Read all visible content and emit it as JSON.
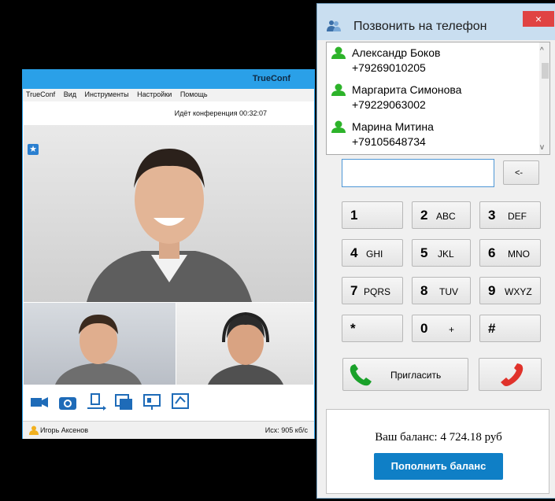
{
  "left_window": {
    "title": "TrueConf",
    "menu": [
      "TrueConf",
      "Вид",
      "Инструменты",
      "Настройки",
      "Помощь"
    ],
    "conference_status": "Идёт конференция 00:32:07",
    "user_name": "Игорь Аксенов",
    "bitrate": "Исх: 905 кб/с",
    "toolbar_icons": [
      "camera-icon",
      "photo-icon",
      "file-transfer-icon",
      "slideshow-icon",
      "screen-share-icon",
      "whiteboard-icon"
    ]
  },
  "dialer": {
    "title": "Позвонить на телефон",
    "close_glyph": "×",
    "contacts": [
      {
        "name": "Александр Боков",
        "phone": "+79269010205"
      },
      {
        "name": "Маргарита Симонова",
        "phone": "+79229063002"
      },
      {
        "name": "Марина Митина",
        "phone": "+79105648734"
      }
    ],
    "phone_value": "",
    "backspace_label": "<-",
    "keys": [
      {
        "digit": "1",
        "letters": ""
      },
      {
        "digit": "2",
        "letters": "ABC"
      },
      {
        "digit": "3",
        "letters": "DEF"
      },
      {
        "digit": "4",
        "letters": "GHI"
      },
      {
        "digit": "5",
        "letters": "JKL"
      },
      {
        "digit": "6",
        "letters": "MNO"
      },
      {
        "digit": "7",
        "letters": "PQRS"
      },
      {
        "digit": "8",
        "letters": "TUV"
      },
      {
        "digit": "9",
        "letters": "WXYZ"
      },
      {
        "digit": "*",
        "letters": ""
      },
      {
        "digit": "0",
        "letters": "+"
      },
      {
        "digit": "#",
        "letters": ""
      }
    ],
    "invite_label": "Пригласить",
    "balance_text": "Ваш баланс: 4 724.18 руб",
    "topup_label": "Пополнить баланс",
    "colors": {
      "accent": "#0f7fc6",
      "call_green": "#1aa12a",
      "hangup_red": "#e0322b",
      "online": "#2db32a"
    }
  }
}
